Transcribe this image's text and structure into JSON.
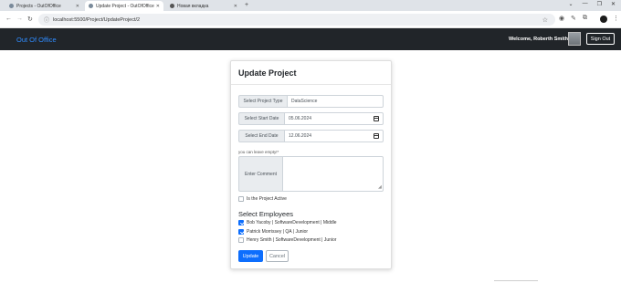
{
  "browser": {
    "tabs": [
      {
        "title": "Projects - OutOfOffice",
        "active": false
      },
      {
        "title": "Update Project - OutOfOffice",
        "active": true
      },
      {
        "title": "Новая вкладка",
        "active": false
      }
    ],
    "new_tab_glyph": "+",
    "url": "localhost:5500/Project/UpdateProject/2",
    "window_controls": [
      "⌄",
      "—",
      "❐",
      "✕"
    ]
  },
  "navbar": {
    "brand": "Out Of Office",
    "welcome": "Welcome, Roberth Smith",
    "sign_out": "Sign Out"
  },
  "form": {
    "title": "Update Project",
    "project_type": {
      "label": "Select Project Type",
      "value": "DataScience"
    },
    "start_date": {
      "label": "Select Start Date",
      "value": "05.06.2024"
    },
    "end_date": {
      "label": "Select End Date",
      "value": "12.06.2024"
    },
    "comment_hint": "you can leave empty!*",
    "comment": {
      "label": "Enter Comment",
      "value": ""
    },
    "is_active": {
      "label": "Is the Project Active",
      "checked": false
    },
    "employees_title": "Select Employees",
    "employees": [
      {
        "label": "Bob Yacoby | SoftwareDevelopment | Middle",
        "checked": true
      },
      {
        "label": "Patrick Morrissey | QA | Junior",
        "checked": true
      },
      {
        "label": "Henry Smith | SoftwareDevelopment | Junior",
        "checked": false
      }
    ],
    "update_button": "Update",
    "cancel_button": "Cancel"
  },
  "colors": {
    "navbar_bg": "#212529",
    "brand": "#2f8cff",
    "primary": "#0d6efd"
  }
}
